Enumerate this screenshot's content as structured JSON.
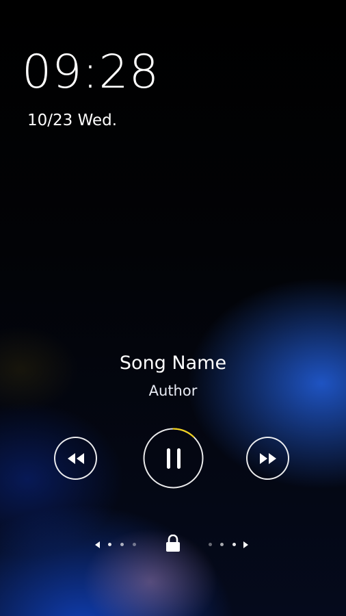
{
  "lockscreen": {
    "time": "09:28",
    "date": "10/23 Wed."
  },
  "player": {
    "song_name": "Song Name",
    "author": "Author",
    "progress_fraction": 0.12,
    "buttons": {
      "previous": "rewind-icon",
      "play_pause": "pause-icon",
      "next": "fast-forward-icon"
    },
    "accent_color": "#f2d21c"
  },
  "unlock_slider": {
    "icon": "lock-icon",
    "left_hint": "chevron-left-icon",
    "right_hint": "chevron-right-icon"
  }
}
